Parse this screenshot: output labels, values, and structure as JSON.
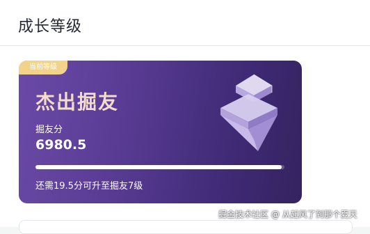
{
  "header": {
    "title": "成长等级"
  },
  "level_card": {
    "badge": "当前等级",
    "level_name": "杰出掘友",
    "score_label": "掘友分",
    "score_value": "6980.5",
    "progress_fraction": 0.99,
    "hint": "还需19.5分可升至掘友7级",
    "icon": "crystal-gem-icon"
  },
  "watermark": "掘金技术社区 @ 从起风了到那个夏天",
  "colors": {
    "card_gradient_start": "#6a4aa6",
    "card_gradient_end": "#34235f",
    "badge": "#f1d38a",
    "level_name": "#f3dcc9"
  }
}
